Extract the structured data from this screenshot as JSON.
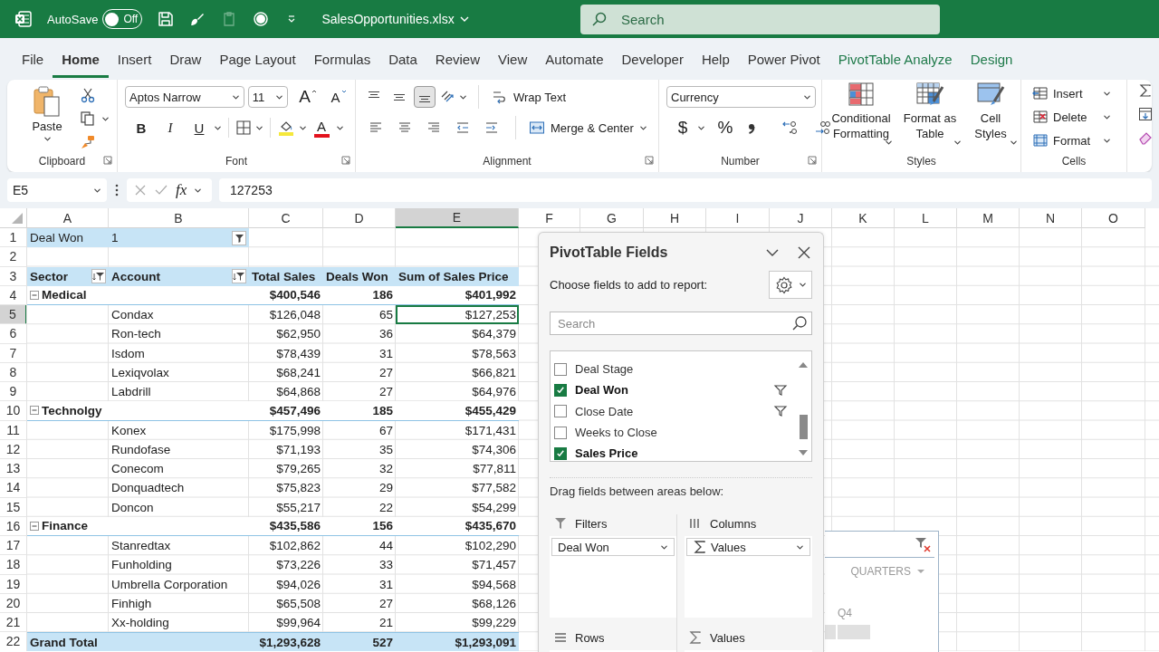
{
  "title_bar": {
    "autosave_label": "AutoSave",
    "autosave": {
      "on": false,
      "label": "Off"
    },
    "file_name": "SalesOpportunities.xlsx",
    "search_placeholder": "Search"
  },
  "ribbon_tabs": [
    {
      "label": "File",
      "selected": false,
      "kind": "standard"
    },
    {
      "label": "Home",
      "selected": true,
      "kind": "standard"
    },
    {
      "label": "Insert",
      "selected": false,
      "kind": "standard"
    },
    {
      "label": "Draw",
      "selected": false,
      "kind": "standard"
    },
    {
      "label": "Page Layout",
      "selected": false,
      "kind": "standard"
    },
    {
      "label": "Formulas",
      "selected": false,
      "kind": "standard"
    },
    {
      "label": "Data",
      "selected": false,
      "kind": "standard"
    },
    {
      "label": "Review",
      "selected": false,
      "kind": "standard"
    },
    {
      "label": "View",
      "selected": false,
      "kind": "standard"
    },
    {
      "label": "Automate",
      "selected": false,
      "kind": "standard"
    },
    {
      "label": "Developer",
      "selected": false,
      "kind": "standard"
    },
    {
      "label": "Help",
      "selected": false,
      "kind": "standard"
    },
    {
      "label": "Power Pivot",
      "selected": false,
      "kind": "standard"
    },
    {
      "label": "PivotTable Analyze",
      "selected": false,
      "kind": "contextual"
    },
    {
      "label": "Design",
      "selected": false,
      "kind": "contextual"
    }
  ],
  "ribbon": {
    "clipboard": {
      "label": "Clipboard",
      "paste": "Paste"
    },
    "font": {
      "label": "Font",
      "font_name": "Aptos Narrow",
      "font_size": "11",
      "grow": "A",
      "shrink": "A",
      "bold": "B",
      "italic": "I",
      "underline": "U",
      "font_color": "A"
    },
    "alignment": {
      "label": "Alignment",
      "vertical_align": [
        {
          "selected": false
        },
        {
          "selected": false
        },
        {
          "selected": true
        }
      ],
      "wrap_text": "Wrap Text",
      "merge_center": "Merge & Center"
    },
    "number": {
      "label": "Number",
      "format": "Currency",
      "currency": "$",
      "percent": "%"
    },
    "styles": {
      "label": "Styles",
      "buttons": [
        {
          "label": "Conditional Formatting",
          "kind": "conditional"
        },
        {
          "label": "Format as Table",
          "kind": "table"
        },
        {
          "label": "Cell Styles",
          "kind": "cellstyles"
        }
      ]
    },
    "cells": {
      "label": "Cells",
      "buttons": [
        {
          "label": "Insert",
          "kind": "insert"
        },
        {
          "label": "Delete",
          "kind": "delete"
        },
        {
          "label": "Format",
          "kind": "format"
        }
      ]
    }
  },
  "formula_bar": {
    "name_box": "E5",
    "fx": "fx",
    "formula": "127253"
  },
  "sheet": {
    "columns": [
      {
        "label": "A",
        "selected": false
      },
      {
        "label": "B",
        "selected": false
      },
      {
        "label": "C",
        "selected": false
      },
      {
        "label": "D",
        "selected": false
      },
      {
        "label": "E",
        "selected": true
      },
      {
        "label": "F",
        "selected": false
      },
      {
        "label": "G",
        "selected": false
      },
      {
        "label": "H",
        "selected": false
      },
      {
        "label": "I",
        "selected": false
      },
      {
        "label": "J",
        "selected": false
      },
      {
        "label": "K",
        "selected": false
      },
      {
        "label": "L",
        "selected": false
      },
      {
        "label": "M",
        "selected": false
      },
      {
        "label": "N",
        "selected": false
      },
      {
        "label": "O",
        "selected": false
      }
    ],
    "rows": [
      {
        "number": "1",
        "selected": false,
        "kind": "filter",
        "label": "Deal Won",
        "value": "1"
      },
      {
        "number": "2",
        "selected": false,
        "kind": "blank"
      },
      {
        "number": "3",
        "selected": false,
        "kind": "header",
        "cells": [
          {
            "text": "Sector",
            "filter_button": true
          },
          {
            "text": "Account",
            "filter_button": true
          },
          {
            "text": "Total Sales",
            "filter_button": false
          },
          {
            "text": "Deals Won",
            "filter_button": false
          },
          {
            "text": "Sum of Sales Price",
            "filter_button": false
          }
        ]
      },
      {
        "number": "4",
        "selected": false,
        "kind": "group",
        "expanded": true,
        "label": "Medical",
        "values": [
          "$400,546",
          "186",
          "$401,992"
        ]
      },
      {
        "number": "5",
        "selected": true,
        "kind": "item",
        "label": "Condax",
        "values": [
          "$126,048",
          "65",
          "$127,253"
        ]
      },
      {
        "number": "6",
        "selected": false,
        "kind": "item",
        "label": "Ron-tech",
        "values": [
          "$62,950",
          "36",
          "$64,379"
        ]
      },
      {
        "number": "7",
        "selected": false,
        "kind": "item",
        "label": "Isdom",
        "values": [
          "$78,439",
          "31",
          "$78,563"
        ]
      },
      {
        "number": "8",
        "selected": false,
        "kind": "item",
        "label": "Lexiqvolax",
        "values": [
          "$68,241",
          "27",
          "$66,821"
        ]
      },
      {
        "number": "9",
        "selected": false,
        "kind": "item",
        "label": "Labdrill",
        "values": [
          "$64,868",
          "27",
          "$64,976"
        ]
      },
      {
        "number": "10",
        "selected": false,
        "kind": "group",
        "expanded": true,
        "label": "Technolgy",
        "values": [
          "$457,496",
          "185",
          "$455,429"
        ]
      },
      {
        "number": "11",
        "selected": false,
        "kind": "item",
        "label": "Konex",
        "values": [
          "$175,998",
          "67",
          "$171,431"
        ]
      },
      {
        "number": "12",
        "selected": false,
        "kind": "item",
        "label": "Rundofase",
        "values": [
          "$71,193",
          "35",
          "$74,306"
        ]
      },
      {
        "number": "13",
        "selected": false,
        "kind": "item",
        "label": "Conecom",
        "values": [
          "$79,265",
          "32",
          "$77,811"
        ]
      },
      {
        "number": "14",
        "selected": false,
        "kind": "item",
        "label": "Donquadtech",
        "values": [
          "$75,823",
          "29",
          "$77,582"
        ]
      },
      {
        "number": "15",
        "selected": false,
        "kind": "item",
        "label": "Doncon",
        "values": [
          "$55,217",
          "22",
          "$54,299"
        ]
      },
      {
        "number": "16",
        "selected": false,
        "kind": "group",
        "expanded": true,
        "label": "Finance",
        "values": [
          "$435,586",
          "156",
          "$435,670"
        ]
      },
      {
        "number": "17",
        "selected": false,
        "kind": "item",
        "label": "Stanredtax",
        "values": [
          "$102,862",
          "44",
          "$102,290"
        ]
      },
      {
        "number": "18",
        "selected": false,
        "kind": "item",
        "label": "Funholding",
        "values": [
          "$73,226",
          "33",
          "$71,457"
        ]
      },
      {
        "number": "19",
        "selected": false,
        "kind": "item",
        "label": "Umbrella Corporation",
        "values": [
          "$94,026",
          "31",
          "$94,568"
        ]
      },
      {
        "number": "20",
        "selected": false,
        "kind": "item",
        "label": "Finhigh",
        "values": [
          "$65,508",
          "27",
          "$68,126"
        ]
      },
      {
        "number": "21",
        "selected": false,
        "kind": "item",
        "label": "Xx-holding",
        "values": [
          "$99,964",
          "21",
          "$99,229"
        ]
      },
      {
        "number": "22",
        "selected": false,
        "kind": "total",
        "label": "Grand Total",
        "values": [
          "$1,293,628",
          "527",
          "$1,293,091"
        ]
      }
    ]
  },
  "pivot_fields": {
    "title": "PivotTable Fields",
    "instruction": "Choose fields to add to report:",
    "search_placeholder": "Search",
    "fields": [
      {
        "label": "Deal Stage",
        "checked": false,
        "filtered": false
      },
      {
        "label": "Deal Won",
        "checked": true,
        "filtered": true
      },
      {
        "label": "Close Date",
        "checked": false,
        "filtered": true
      },
      {
        "label": "Weeks to Close",
        "checked": false,
        "filtered": false
      },
      {
        "label": "Sales Price",
        "checked": true,
        "filtered": false
      }
    ],
    "areas_instruction": "Drag fields between areas below:",
    "areas": [
      {
        "kind": "filters",
        "label": "Filters",
        "items": [
          {
            "label": "Deal Won",
            "kind": "field"
          }
        ]
      },
      {
        "kind": "columns",
        "label": "Columns",
        "items": [
          {
            "label": "Values",
            "kind": "values"
          }
        ]
      },
      {
        "kind": "rows",
        "label": "Rows"
      },
      {
        "kind": "values",
        "label": "Values"
      }
    ]
  },
  "timeline": {
    "level_label": "QUARTERS",
    "periods": [
      "Q4"
    ]
  }
}
